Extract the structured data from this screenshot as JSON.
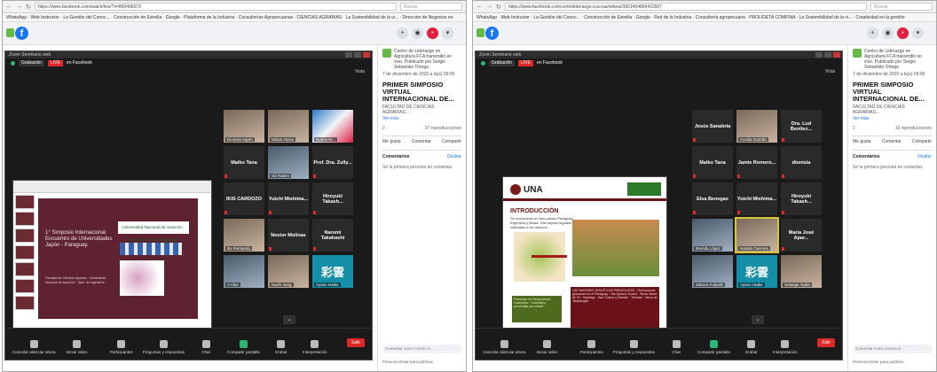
{
  "left": {
    "url": "https://www.facebook.com/watch/live/?v=860496573",
    "search_placeholder": "Buscar",
    "bookmarks": "WhatsApp  ·  Web Instructor  ·  La Gestión del Conoc...  ·  Construcción de Estrella  ·  Google  ·  Plataforma de la Industria  ·  Consultorías Agropecuarias  ·  CIENCIAS AGRARIAS  ·  La Sostenibilidad de la vi...  ·  Dirección de Negocios en",
    "zoom_title": "Zoom Seminario web",
    "grabacion": "Grabación",
    "live": "LIVE",
    "live_on": "en Facebook",
    "vista": "Vista",
    "slide": {
      "title": "1° Simposio Internacional Encuentro de Universidades Japón - Paraguay.",
      "logo_text": "Universidad Nacional de Asunción · Facultad de Ciencias Agrarias",
      "small_text": "Facultad de Ciencias Agrarias · Universidad Nacional de Asunción · Dpto. de Ingeniería"
    },
    "tiles": [
      {
        "text": "",
        "label": "Dionisio Aquín",
        "kind": "video"
      },
      {
        "text": "",
        "label": "Mirian Hizou",
        "kind": "video"
      },
      {
        "text": "",
        "label": "Nuevo Ar...",
        "kind": "art"
      },
      {
        "text": "Maiko Tana",
        "label": "",
        "kind": "name"
      },
      {
        "text": "",
        "label": "Gil Ruben",
        "kind": "video2"
      },
      {
        "text": "Prof. Dra. Zully...",
        "label": "",
        "kind": "name"
      },
      {
        "text": "IKIS CARDOZO",
        "label": "",
        "kind": "name"
      },
      {
        "text": "Yuichi Mishima...",
        "label": "",
        "kind": "name"
      },
      {
        "text": "Hiroyuki Takash...",
        "label": "",
        "kind": "name"
      },
      {
        "text": "",
        "label": "Bo Fernando",
        "kind": "video"
      },
      {
        "text": "Nestor Molinas",
        "label": "",
        "kind": "name"
      },
      {
        "text": "Narumi Takahashi",
        "label": "",
        "kind": "name"
      },
      {
        "text": "",
        "label": "A Alex",
        "kind": "video2"
      },
      {
        "text": "",
        "label": "Nachi Jung",
        "kind": "video"
      },
      {
        "text": "彩雲",
        "label": "Ayano Haibe",
        "kind": "caiyun"
      }
    ],
    "toolbar": [
      "Cancelar silenciar ahora",
      "Iniciar video",
      "Participantes",
      "Preguntas y respuestas",
      "Chat",
      "Compartir pantalla",
      "Grabar",
      "Interpretación"
    ],
    "participants_count": "253",
    "end": "Salir",
    "fb": {
      "page": "Centro de Liderazgo en Agricultura FCA transmitió en vivo. Publicado por Sergio Sebastián Ortega",
      "date": "7 de diciembre de 2020 a la(s) 09:00",
      "post_title": "PRIMER SIMPOSIO VIRTUAL INTERNACIONAL DE...",
      "faculty": "FACULTAD DE CIENCIAS AGRARIAS...",
      "more": "Ver más",
      "reactions": "2",
      "views": "37 reproducciones",
      "like": "Me gusta",
      "comment": "Comentar",
      "share": "Compartir",
      "comments_header": "Comentarios",
      "comments_link": "Ocultar",
      "comments_note": "Sé la primera persona en comentar.",
      "comment_placeholder": "Comentar como Centro d...",
      "enter_hint": "Presiona Enter para publicar."
    }
  },
  "right": {
    "url": "https://www.facebook.com/centroliderazgo.cca.rua/videos/3821454896415507",
    "search_placeholder": "Buscar",
    "bookmarks": "WhatsApp  ·  Web Instructor  ·  La Gestión del Conoc...  ·  Construcción de Estrella  ·  Google  ·  Red de la Industria  ·  Consultoría agropecuaria  ·  PROLIDETA COMFINA  ·  La Sostenibilidad de la vi...  ·  Creatividad en la gestión",
    "zoom_title": "Zoom Seminario web",
    "grabacion": "Grabación",
    "live": "LIVE",
    "live_on": "en Facebook",
    "vista": "Vista",
    "slide": {
      "una": "UNA",
      "heading": "INTRODUCCIÓN",
      "intro": "Se encuentran en tres países Paraguay, Argentina y Brasil. Han dejado legados culturales a los mismos.",
      "table1": "Población de Reducciones Guaraníes · Cantidad y porcentaje por misión",
      "table2": "LAS MISIONES JESUÍTICAS PARAGUAYAS · Reducciones guaraníes en el Paraguay · San Ignacio Guazú · Santa María de Fe · Santiago · San Cosme y Damián · Trinidad · Jesús de Tavarangüé"
    },
    "tiles": [
      {
        "text": "Jesús Sanabria",
        "label": "",
        "kind": "name"
      },
      {
        "text": "",
        "label": "Cecilia Garrido",
        "kind": "video"
      },
      {
        "text": "Dra. Lud Benítez...",
        "label": "",
        "kind": "name"
      },
      {
        "text": "Maiko Tana",
        "label": "",
        "kind": "name"
      },
      {
        "text": "Jamie Romero...",
        "label": "",
        "kind": "name"
      },
      {
        "text": "dionisia",
        "label": "",
        "kind": "name"
      },
      {
        "text": "Elsa Benegas",
        "label": "",
        "kind": "name"
      },
      {
        "text": "Yuichi Mishima...",
        "label": "",
        "kind": "name"
      },
      {
        "text": "Hiroyuki Takash...",
        "label": "",
        "kind": "name"
      },
      {
        "text": "",
        "label": "Brenda López",
        "kind": "video2"
      },
      {
        "text": "",
        "label": "Natalia Caceres",
        "kind": "video",
        "active": true
      },
      {
        "text": "María José Apar...",
        "label": "",
        "kind": "name"
      },
      {
        "text": "",
        "label": "Sakura Fukushi",
        "kind": "video2"
      },
      {
        "text": "彩雲",
        "label": "Ayano Haibe",
        "kind": "caiyun"
      },
      {
        "text": "",
        "label": "Solange Ayala",
        "kind": "video"
      }
    ],
    "toolbar": [
      "Cancelar silenciar ahora",
      "Iniciar video",
      "Participantes",
      "Preguntas y respuestas",
      "Chat",
      "Compartir pantalla",
      "Grabar",
      "Interpretación"
    ],
    "participants_count": "253",
    "end": "Salir",
    "fb": {
      "page": "Centro de Liderazgo en Agricultura FCA transmitió en vivo. Publicado por Sergio Sebastián Ortega",
      "date": "7 de diciembre de 2020 a la(s) 09:00",
      "post_title": "PRIMER SIMPOSIO VIRTUAL INTERNACIONAL DE...",
      "faculty": "FACULTAD DE CIENCIAS AGRARIAS...",
      "more": "Ver más",
      "reactions": "2",
      "views": "16 reproducciones",
      "like": "Me gusta",
      "comment": "Comentar",
      "share": "Compartir",
      "comments_header": "Comentarios",
      "comments_link": "Ocultar",
      "comments_note": "Sé la primera persona en comentar.",
      "comment_placeholder": "Comentar como Centro d...",
      "enter_hint": "Presiona Enter para publicar."
    }
  }
}
